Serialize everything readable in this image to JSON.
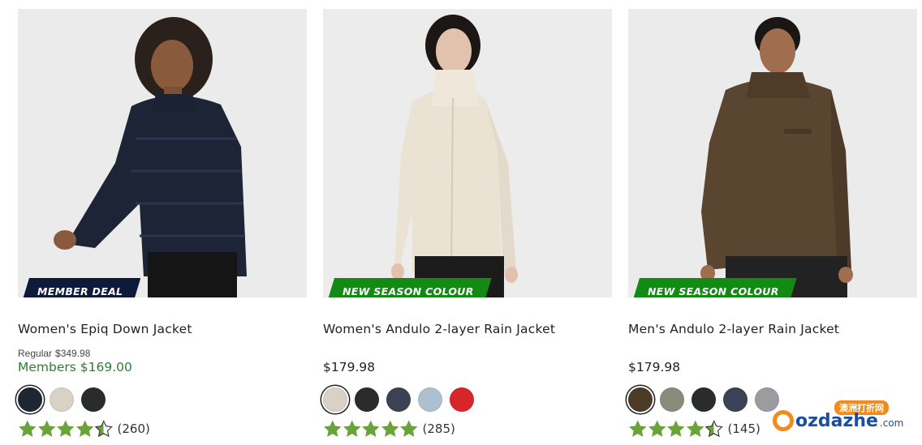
{
  "products": [
    {
      "badge": "MEMBER DEAL",
      "badge_style": "dark",
      "title": "Women's Epiq Down Jacket",
      "regular_label": "Regular",
      "regular_price": "$349.98",
      "members_price": "Members $169.00",
      "price": null,
      "swatches": [
        "#1e2533",
        "#d8d2c4",
        "#2a2b2d"
      ],
      "selected_swatch": 0,
      "rating": 4.5,
      "review_count": "(260)",
      "image": "woman in navy puffer down jacket"
    },
    {
      "badge": "NEW SEASON COLOUR",
      "badge_style": "green",
      "title": "Women's Andulo 2-layer Rain Jacket",
      "regular_label": null,
      "regular_price": null,
      "members_price": null,
      "price": "$179.98",
      "swatches": [
        "#d9d1c3",
        "#2a2b2d",
        "#3b4253",
        "#aebfcf",
        "#d7262b"
      ],
      "selected_swatch": 0,
      "rating": 5,
      "review_count": "(285)",
      "image": "woman in cream rain jacket"
    },
    {
      "badge": "NEW SEASON COLOUR",
      "badge_style": "green",
      "title": "Men's Andulo 2-layer Rain Jacket",
      "regular_label": null,
      "regular_price": null,
      "members_price": null,
      "price": "$179.98",
      "swatches": [
        "#4c3b27",
        "#8a8b79",
        "#2a2b2d",
        "#3b4253",
        "#9a9ca0"
      ],
      "selected_swatch": 0,
      "rating": 4.5,
      "review_count": "(145)",
      "image": "man in brown rain jacket"
    }
  ],
  "colors": {
    "star": "#6aa33a",
    "member_green": "#2e7d32",
    "badge_dark": "#0d1a3a",
    "badge_green": "#138a14"
  },
  "watermark": {
    "chinese": "澳洲打折网",
    "brand": "ozdazhe",
    "suffix": ".com"
  }
}
